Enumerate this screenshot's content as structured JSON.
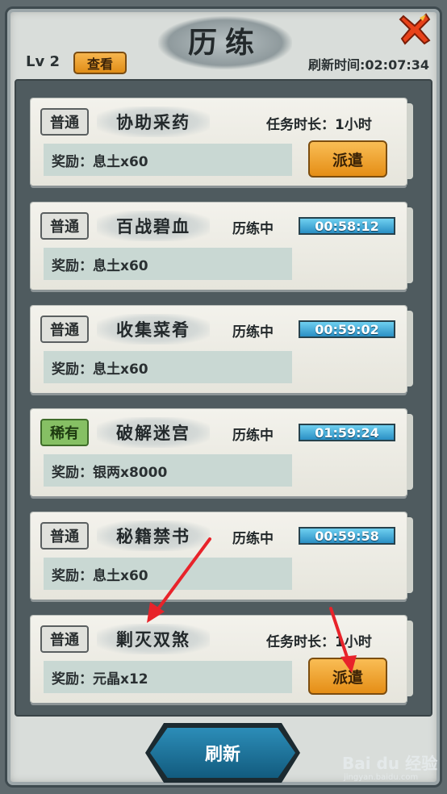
{
  "header": {
    "title": "历练",
    "level": "Lv 2",
    "view_button": "查看",
    "refresh_time": "刷新时间:02:07:34"
  },
  "tasks": [
    {
      "tag": "普通",
      "rarity": "normal",
      "name": "协助采药",
      "mode": "idle",
      "duration": "任务时长：1小时",
      "reward": "奖励：息土x60",
      "action": "派遣"
    },
    {
      "tag": "普通",
      "rarity": "normal",
      "name": "百战碧血",
      "mode": "running",
      "status": "历练中",
      "timer": "00:58:12",
      "reward": "奖励：息土x60"
    },
    {
      "tag": "普通",
      "rarity": "normal",
      "name": "收集菜肴",
      "mode": "running",
      "status": "历练中",
      "timer": "00:59:02",
      "reward": "奖励：息土x60"
    },
    {
      "tag": "稀有",
      "rarity": "rare",
      "name": "破解迷宫",
      "mode": "running",
      "status": "历练中",
      "timer": "01:59:24",
      "reward": "奖励：银两x8000"
    },
    {
      "tag": "普通",
      "rarity": "normal",
      "name": "秘籍禁书",
      "mode": "running",
      "status": "历练中",
      "timer": "00:59:58",
      "reward": "奖励：息土x60"
    },
    {
      "tag": "普通",
      "rarity": "normal",
      "name": "剿灭双煞",
      "mode": "idle",
      "duration": "任务时长：1小时",
      "reward": "奖励：元晶x12",
      "action": "派遣"
    }
  ],
  "footer": {
    "refresh_button": "刷新"
  },
  "watermark": {
    "brand": "Bai du 经验",
    "url": "jingyan.baidu.com"
  },
  "colors": {
    "accent_orange": "#e58e16",
    "timer_blue": "#2a8fc4",
    "rare_green": "#86c064",
    "annotation_red": "#e8232a"
  }
}
